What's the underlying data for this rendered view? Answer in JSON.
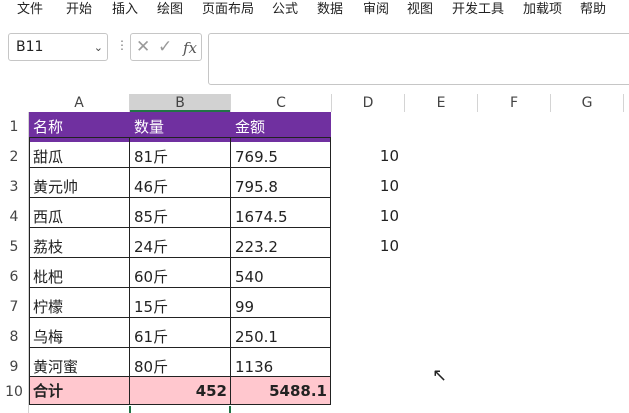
{
  "ribbon": {
    "tabs": [
      "文件",
      "开始",
      "插入",
      "绘图",
      "页面布局",
      "公式",
      "数据",
      "审阅",
      "视图",
      "开发工具",
      "加载项",
      "帮助"
    ]
  },
  "formula_bar": {
    "name_box": "B11",
    "fx": "fx",
    "formula": ""
  },
  "columns": [
    "A",
    "B",
    "C",
    "D",
    "E",
    "F",
    "G"
  ],
  "rows": [
    "1",
    "2",
    "3",
    "4",
    "5",
    "6",
    "7",
    "8",
    "9",
    "10"
  ],
  "table": {
    "header": [
      "名称",
      "数量",
      "金额"
    ],
    "data": [
      [
        "甜瓜",
        "81斤",
        "769.5"
      ],
      [
        "黄元帅",
        "46斤",
        "795.8"
      ],
      [
        "西瓜",
        "85斤",
        "1674.5"
      ],
      [
        "荔枝",
        "24斤",
        "223.2"
      ],
      [
        "枇杷",
        "60斤",
        "540"
      ],
      [
        "柠檬",
        "15斤",
        "99"
      ],
      [
        "乌梅",
        "61斤",
        "250.1"
      ],
      [
        "黄河蜜",
        "80斤",
        "1136"
      ]
    ],
    "total": [
      "合计",
      "452",
      "5488.1"
    ]
  },
  "column_d": [
    "10",
    "10",
    "10",
    "10"
  ],
  "colors": {
    "header_fill": "#7030a0",
    "total_fill": "#ffc7ce",
    "selection": "#217346"
  }
}
